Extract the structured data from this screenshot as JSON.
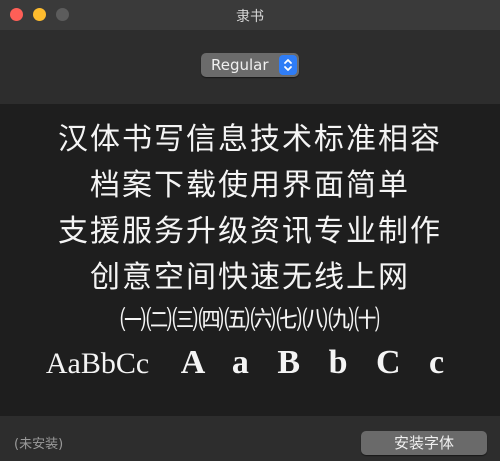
{
  "window": {
    "title": "隶书"
  },
  "style_selector": {
    "selected": "Regular"
  },
  "preview": {
    "lines": [
      "汉体书写信息技术标准相容",
      "档案下载使用界面简单",
      "支援服务升级资讯专业制作",
      "创意空间快速无线上网",
      "㈠㈡㈢㈣㈤㈥㈦㈧㈨㈩"
    ],
    "latin_sample": "AaBbCc",
    "latin_large": "A a B b C c"
  },
  "footer": {
    "status": "(未安装)",
    "install_label": "安装字体"
  },
  "colors": {
    "close": "#fe5f57",
    "minimize": "#febc2e",
    "zoom": "#5c5c5c",
    "accent": "#2f7df6"
  }
}
